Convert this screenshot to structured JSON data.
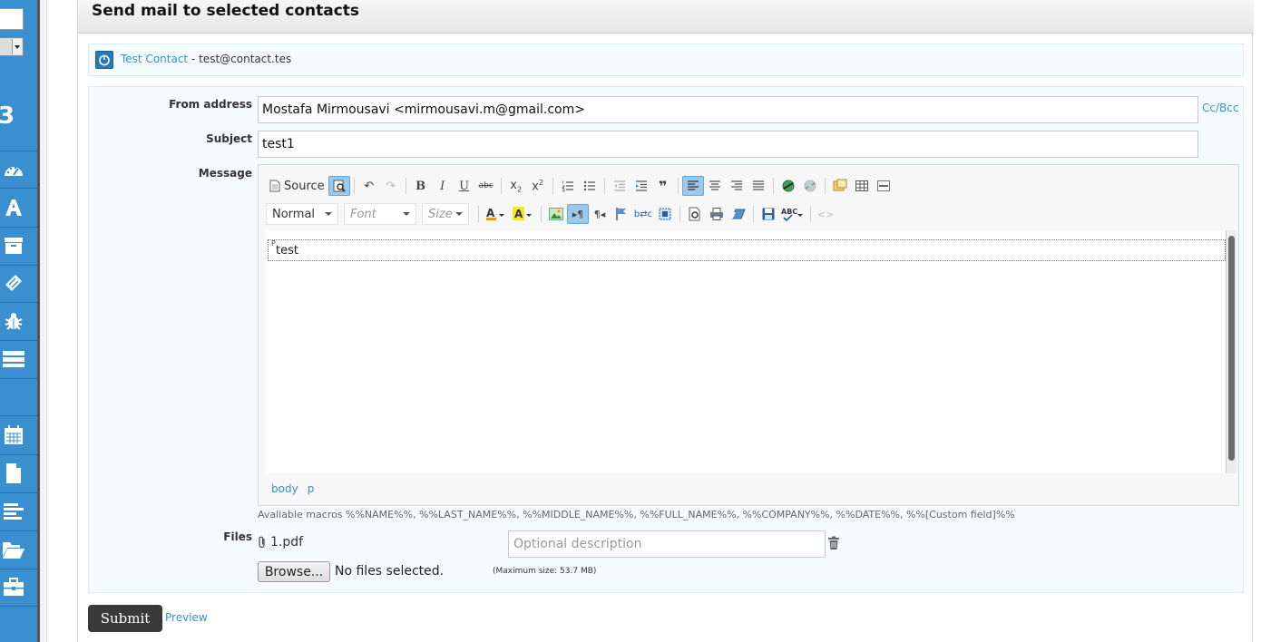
{
  "sidebar": {
    "counter": "3",
    "icons": [
      "dashboard-icon",
      "contacts-icon",
      "archive-icon",
      "tickets-icon",
      "bug-icon",
      "servers-icon",
      "calendar-icon",
      "document-icon",
      "list-icon",
      "folder-icon",
      "briefcase-icon"
    ]
  },
  "header": {
    "title": "Send mail to selected contacts"
  },
  "contact": {
    "name": "Test Contact",
    "email": " - test@contact.tes"
  },
  "form": {
    "from_label": "From address",
    "from_value": "Mostafa Mirmousavi <mirmousavi.m@gmail.com>",
    "ccbcc": "Cc/Bcc",
    "subject_label": "Subject",
    "subject_value": "test1",
    "message_label": "Message",
    "files_label": "Files"
  },
  "editor": {
    "source_label": "Source",
    "format_value": "Normal",
    "font_placeholder": "Font",
    "size_placeholder": "Size",
    "para_tag": "P",
    "content": "test",
    "path": [
      "body",
      "p"
    ]
  },
  "macros": "Avaliable macros %%NAME%%, %%LAST_NAME%%, %%MIDDLE_NAME%%, %%FULL_NAME%%, %%COMPANY%%, %%DATE%%, %%[Custom field]%%",
  "files": {
    "attached": "1.pdf",
    "description_placeholder": "Optional description",
    "browse_label": "Browse...",
    "no_files": "No files selected.",
    "max_size": "(Maximum size: 53.7 MB)"
  },
  "actions": {
    "submit": "Submit",
    "preview": "Preview"
  },
  "colors": {
    "brand": "#3a8fd0",
    "submit_bg": "#3a3a3a",
    "panel_bg": "#f5fcfd"
  }
}
